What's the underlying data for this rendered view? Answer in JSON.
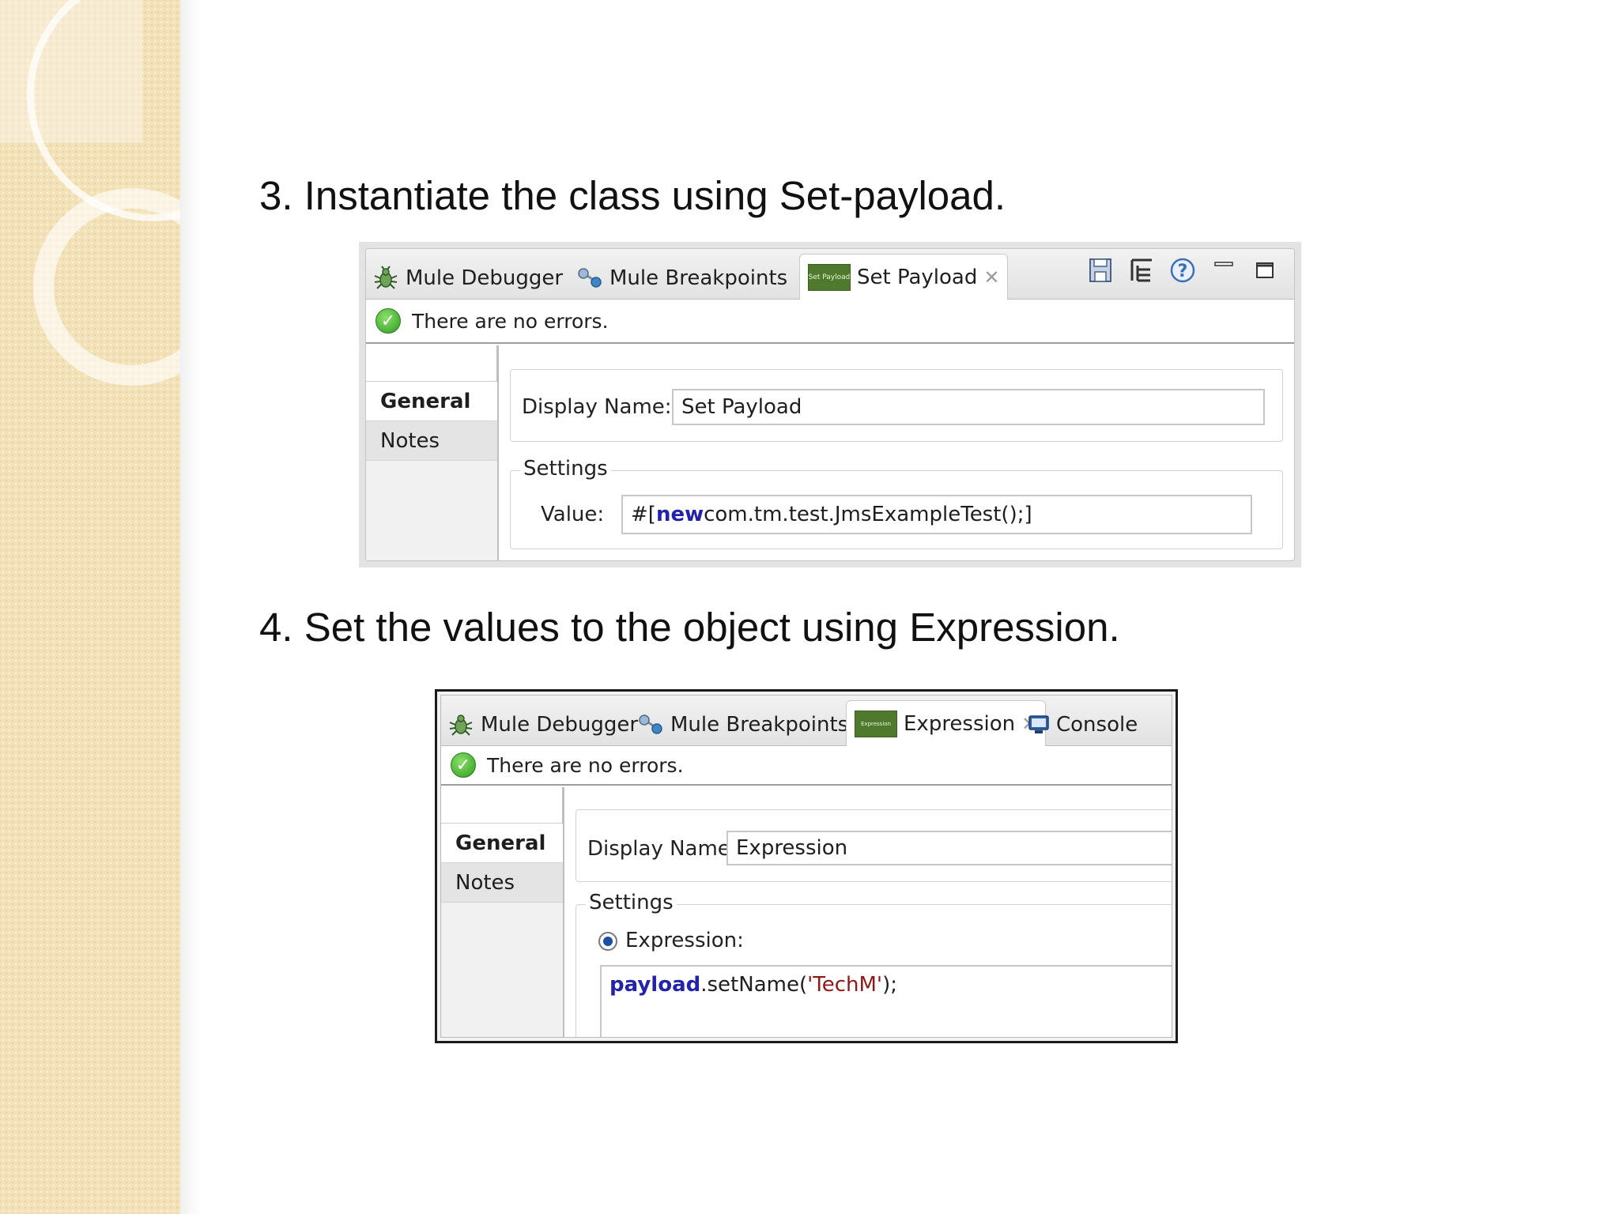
{
  "slide": {
    "step3": "3. Instantiate the class using Set-payload.",
    "step4": "4. Set the values to the object using Expression."
  },
  "panel1": {
    "tabs": [
      {
        "label": "Mule Debugger",
        "icon": "bug-icon"
      },
      {
        "label": "Mule Breakpoints",
        "icon": "breakpoints-icon"
      },
      {
        "label": "Set Payload",
        "icon": "set-payload-icon",
        "icon_text": "Set Payload",
        "active": true
      }
    ],
    "toolbar_icons": [
      "save-icon",
      "tree-icon",
      "help-icon",
      "minimize-icon",
      "maximize-icon"
    ],
    "status": "There are no errors.",
    "sidebar": [
      "General",
      "Notes"
    ],
    "display_name_label": "Display Name:",
    "display_name_value": "Set Payload",
    "settings_title": "Settings",
    "value_label": "Value:",
    "value_prefix": "#[",
    "value_keyword": "new",
    "value_rest": " com.tm.test.JmsExampleTest();]"
  },
  "panel2": {
    "tabs": [
      {
        "label": "Mule Debugger",
        "icon": "bug-icon"
      },
      {
        "label": "Mule Breakpoints",
        "icon": "breakpoints-icon"
      },
      {
        "label": "Expression",
        "icon": "expression-icon",
        "icon_text": "Expression",
        "active": true
      },
      {
        "label": "Console",
        "icon": "console-icon"
      }
    ],
    "status": "There are no errors.",
    "sidebar": [
      "General",
      "Notes"
    ],
    "display_name_label": "Display Name:",
    "display_name_value": "Expression",
    "settings_title": "Settings",
    "radio_label": "Expression:",
    "code_keyword": "payload",
    "code_mid": ".setName(",
    "code_string": "'TechM'",
    "code_end": ");"
  },
  "colors": {
    "band": "#f3e2b8",
    "tab_icon_green": "#4f7a2e",
    "keyword": "#2323a8",
    "string": "#8b1a1a",
    "check_green": "#2f9a21"
  }
}
